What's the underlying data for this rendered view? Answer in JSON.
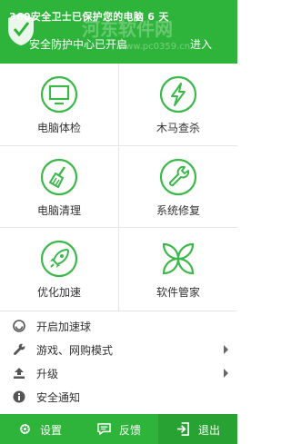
{
  "header": {
    "title": "360安全卫士已保护您的电脑 6 天",
    "subtitle": "安全防护中心已开启",
    "enter_label": "进入",
    "watermark": "河东软件网",
    "watermark_url": "www.pc0359.cn"
  },
  "grid": {
    "items": [
      {
        "label": "电脑体检",
        "icon": "monitor-icon"
      },
      {
        "label": "木马查杀",
        "icon": "lightning-icon"
      },
      {
        "label": "电脑清理",
        "icon": "broom-icon"
      },
      {
        "label": "系统修复",
        "icon": "wrench-icon"
      },
      {
        "label": "优化加速",
        "icon": "rocket-icon"
      },
      {
        "label": "软件管家",
        "icon": "petals-icon"
      }
    ]
  },
  "menu": {
    "items": [
      {
        "label": "开启加速球",
        "icon": "ball-icon",
        "has_submenu": false
      },
      {
        "label": "游戏、网购模式",
        "icon": "wrench-small-icon",
        "has_submenu": true
      },
      {
        "label": "升级",
        "icon": "upload-icon",
        "has_submenu": true
      },
      {
        "label": "安全通知",
        "icon": "info-icon",
        "has_submenu": false
      }
    ]
  },
  "footer": {
    "settings_label": "设置",
    "feedback_label": "反馈",
    "exit_label": "退出"
  },
  "colors": {
    "brand_green": "#2eb43a",
    "icon_green": "#3cb84a",
    "exit_bg": "#28a232"
  }
}
